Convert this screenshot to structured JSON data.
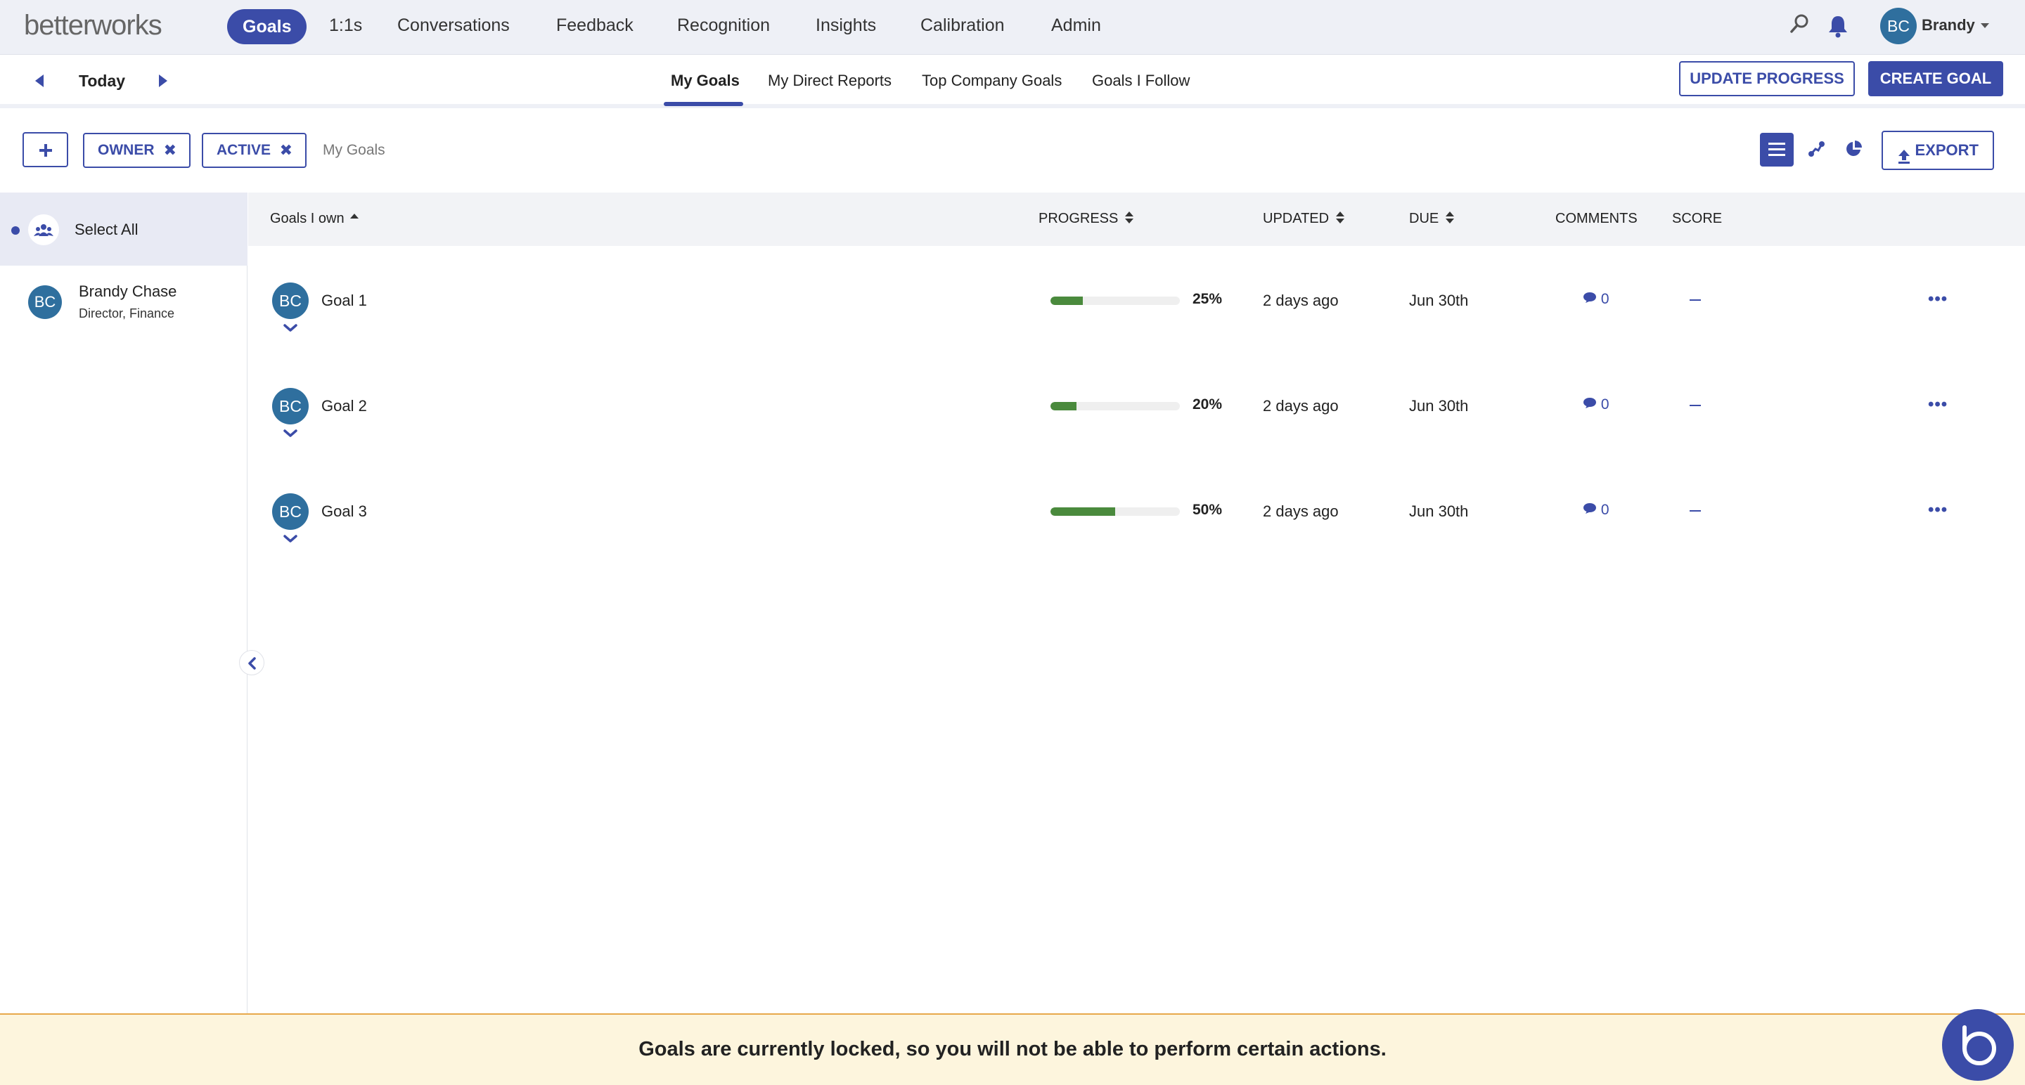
{
  "app": {
    "logo": "betterworks",
    "nav": [
      "Goals",
      "1:1s",
      "Conversations",
      "Feedback",
      "Recognition",
      "Insights",
      "Calibration",
      "Admin"
    ],
    "user_initials": "BC",
    "user_name": "Brandy"
  },
  "subnav": {
    "date_label": "Today",
    "tabs": [
      "My Goals",
      "My Direct Reports",
      "Top Company Goals",
      "Goals I Follow"
    ],
    "active_tab": "My Goals",
    "update_progress": "UPDATE PROGRESS",
    "create_goal": "CREATE GOAL"
  },
  "filters": {
    "chips": [
      "OWNER",
      "ACTIVE"
    ],
    "label": "My Goals",
    "export": "EXPORT"
  },
  "sidebar": {
    "select_all": "Select All",
    "people": [
      {
        "initials": "BC",
        "name": "Brandy Chase",
        "title": "Director, Finance"
      }
    ]
  },
  "table": {
    "headers": {
      "goal": "Goals I own",
      "progress": "PROGRESS",
      "updated": "UPDATED",
      "due": "DUE",
      "comments": "COMMENTS",
      "score": "SCORE"
    },
    "rows": [
      {
        "initials": "BC",
        "name": "Goal 1",
        "progress": 0.25,
        "progress_label": "25%",
        "updated": "2 days ago",
        "due": "Jun 30th",
        "comments": "0"
      },
      {
        "initials": "BC",
        "name": "Goal 2",
        "progress": 0.2,
        "progress_label": "20%",
        "updated": "2 days ago",
        "due": "Jun 30th",
        "comments": "0"
      },
      {
        "initials": "BC",
        "name": "Goal 3",
        "progress": 0.5,
        "progress_label": "50%",
        "updated": "2 days ago",
        "due": "Jun 30th",
        "comments": "0"
      }
    ]
  },
  "banner": {
    "text": "Goals are currently locked, so you will not be able to perform certain actions."
  },
  "colors": {
    "accent": "#3b4ca8",
    "avatar": "#2f6f9e",
    "progress": "#4a8a3d",
    "banner_bg": "#fdf5dd"
  },
  "icons": [
    "search-icon",
    "bell-icon",
    "caret-down-icon",
    "plus-icon",
    "close-icon",
    "list-view-icon",
    "roadmap-view-icon",
    "pie-view-icon",
    "upload-icon",
    "group-icon",
    "chevron-left-icon",
    "chevron-down-icon",
    "comment-icon",
    "more-icon"
  ]
}
